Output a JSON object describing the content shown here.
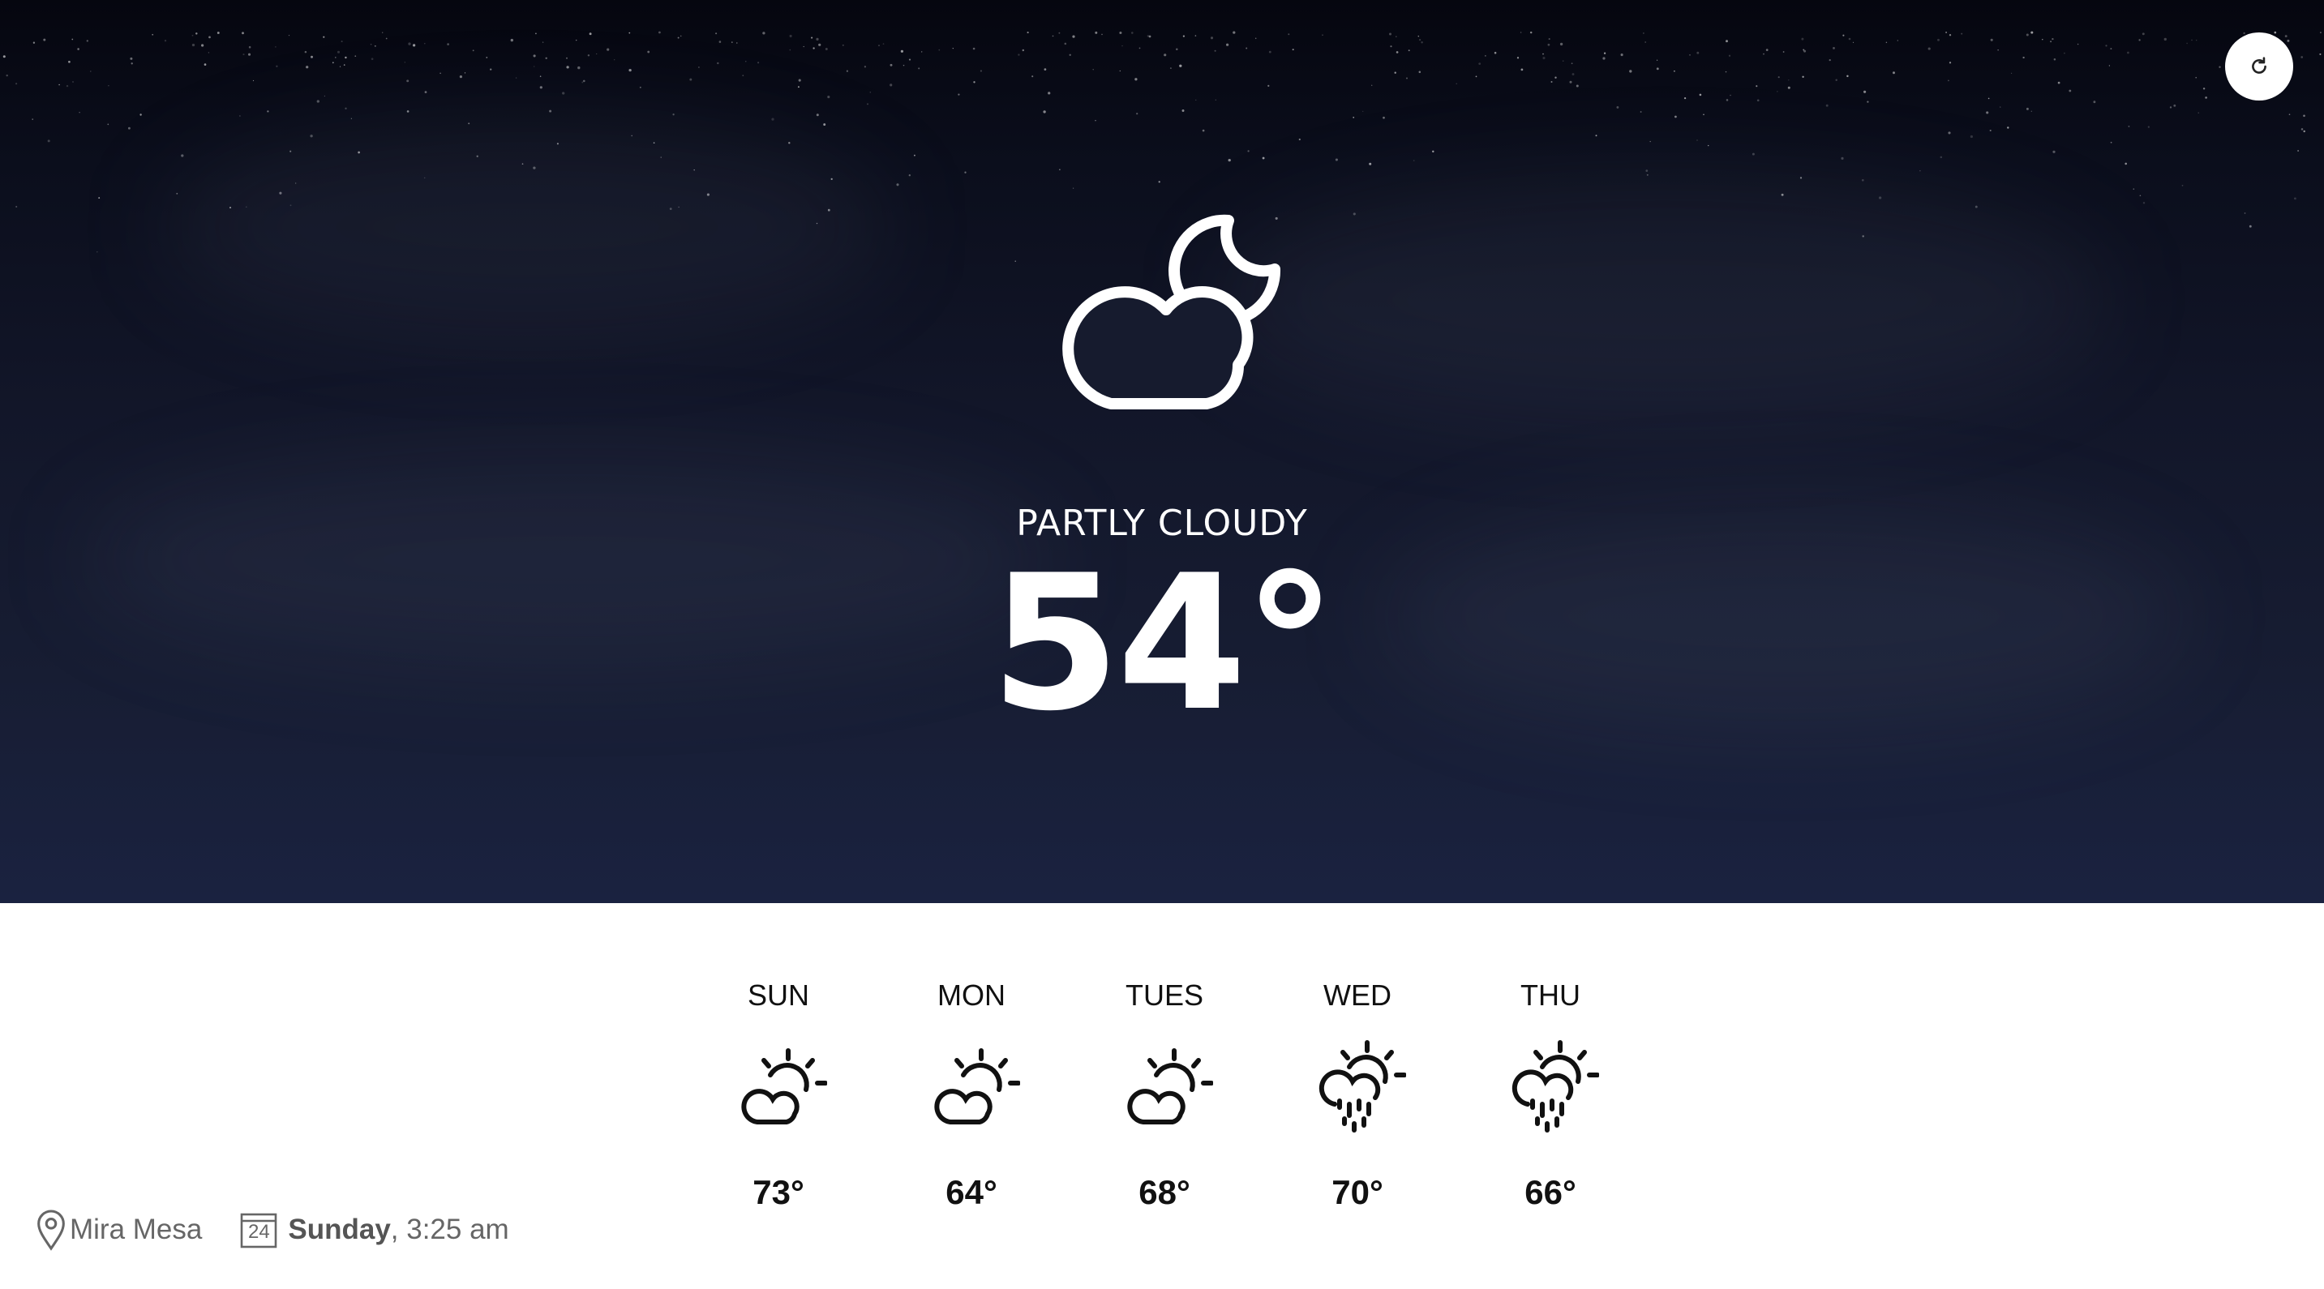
{
  "current": {
    "condition": "PARTLY CLOUDY",
    "temperature": "54°",
    "icon": "cloud-moon-icon"
  },
  "refresh": {
    "icon": "refresh-icon"
  },
  "forecast": [
    {
      "day": "SUN",
      "temp": "73°",
      "icon": "partly-sunny-icon"
    },
    {
      "day": "MON",
      "temp": "64°",
      "icon": "partly-sunny-icon"
    },
    {
      "day": "TUES",
      "temp": "68°",
      "icon": "partly-sunny-icon"
    },
    {
      "day": "WED",
      "temp": "70°",
      "icon": "sun-rain-icon"
    },
    {
      "day": "THU",
      "temp": "66°",
      "icon": "sun-rain-icon"
    }
  ],
  "footer": {
    "location": "Mira Mesa",
    "location_icon": "location-pin-icon",
    "calendar_icon": "calendar-icon",
    "calendar_number": "24",
    "day": "Sunday",
    "time": ", 3:25 am"
  },
  "colors": {
    "sky_top": "#05060f",
    "sky_bottom": "#1a2240",
    "text_light": "#ffffff",
    "text_dark": "#111111"
  }
}
